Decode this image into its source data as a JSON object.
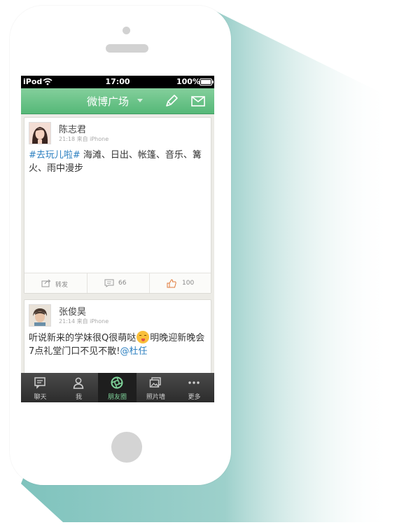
{
  "status_bar": {
    "carrier": "iPod",
    "time": "17:00",
    "battery": "100%"
  },
  "nav": {
    "title": "微博广场"
  },
  "posts": [
    {
      "name": "陈志君",
      "meta": "21:18 来自 iPhone",
      "hashtag": "#去玩儿啦#",
      "text_1": " 海滩、日出、帐篷、音乐、篝火、雨中漫步",
      "repost_label": "转发",
      "comments": "66",
      "likes": "100"
    },
    {
      "name": "张俊昊",
      "meta": "21:14 来自 iPhone",
      "text_1": "听说新来的学妹很Q很萌哒",
      "text_2": "明晚迎新晚会7点礼堂门口不见不散!",
      "mention": "@杜任"
    }
  ],
  "tabs": [
    {
      "label": "聊天"
    },
    {
      "label": "我"
    },
    {
      "label": "朋友圈"
    },
    {
      "label": "照片墙"
    },
    {
      "label": "更多"
    }
  ],
  "colors": {
    "nav_green": "#55b878",
    "link_blue": "#2b7fc0",
    "active_tab": "#7fd49a"
  }
}
